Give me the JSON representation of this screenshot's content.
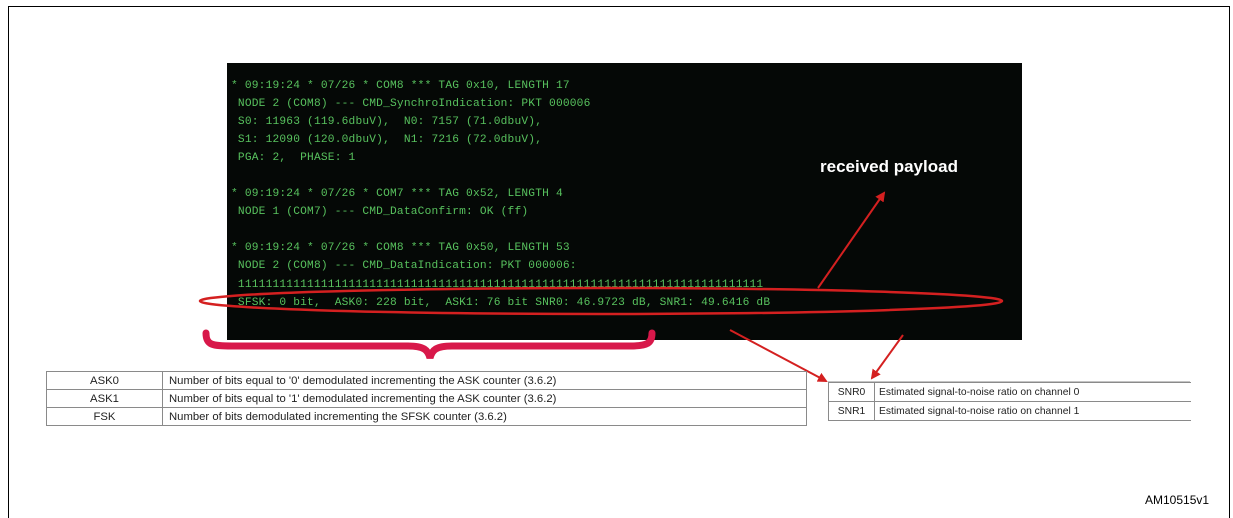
{
  "terminal": {
    "lines": [
      "* 09:19:24 * 07/26 * COM8 *** TAG 0x10, LENGTH 17",
      " NODE 2 (COM8) --- CMD_SynchroIndication: PKT 000006",
      " S0: 11963 (119.6dbuV),  N0: 7157 (71.0dbuV),",
      " S1: 12090 (120.0dbuV),  N1: 7216 (72.0dbuV),",
      " PGA: 2,  PHASE: 1",
      "",
      "* 09:19:24 * 07/26 * COM7 *** TAG 0x52, LENGTH 4",
      " NODE 1 (COM7) --- CMD_DataConfirm: OK (ff)",
      "",
      "* 09:19:24 * 07/26 * COM8 *** TAG 0x50, LENGTH 53",
      " NODE 2 (COM8) --- CMD_DataIndication: PKT 000006:",
      " 1111111111111111111111111111111111111111111111111111111111111111111111111111",
      " SFSK: 0 bit,  ASK0: 228 bit,  ASK1: 76 bit SNR0: 46.9723 dB, SNR1: 49.6416 dB"
    ],
    "annotation": "received payload"
  },
  "left_table": [
    {
      "key": "ASK0",
      "desc": "Number of bits equal to '0' demodulated incrementing the ASK counter (3.6.2)"
    },
    {
      "key": "ASK1",
      "desc": "Number of bits equal to '1' demodulated incrementing the ASK counter  (3.6.2)"
    },
    {
      "key": "FSK",
      "desc": "Number of bits demodulated incrementing the SFSK counter  (3.6.2)"
    }
  ],
  "right_table": [
    {
      "key": "SNR0",
      "desc": "Estimated signal-to-noise ratio on channel 0"
    },
    {
      "key": "SNR1",
      "desc": "Estimated signal-to-noise ratio on channel 1"
    }
  ],
  "figure_id": "AM10515v1",
  "colors": {
    "terminal_bg": "#050806",
    "terminal_text": "#58c25e",
    "arrow": "#d42020",
    "brace": "#d8184a"
  }
}
